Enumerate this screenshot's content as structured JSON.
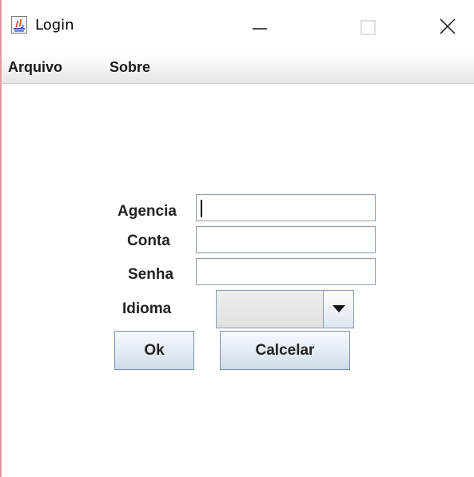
{
  "window": {
    "title": "Login",
    "app_icon": "java-icon",
    "controls": {
      "minimize_icon": "minimize-icon",
      "maximize_icon": "maximize-icon",
      "close_icon": "close-icon"
    }
  },
  "menubar": {
    "items": [
      {
        "label": "Arquivo"
      },
      {
        "label": "Sobre"
      }
    ]
  },
  "form": {
    "agencia": {
      "label": "Agencia",
      "value": ""
    },
    "conta": {
      "label": "Conta",
      "value": ""
    },
    "senha": {
      "label": "Senha",
      "value": ""
    },
    "idioma": {
      "label": "Idioma",
      "selected": ""
    }
  },
  "buttons": {
    "ok_label": "Ok",
    "cancel_label": "Calcelar"
  },
  "colors": {
    "window_border": "#e09aa6",
    "field_border": "#8b9bb0",
    "button_border": "#7b8ea8"
  }
}
